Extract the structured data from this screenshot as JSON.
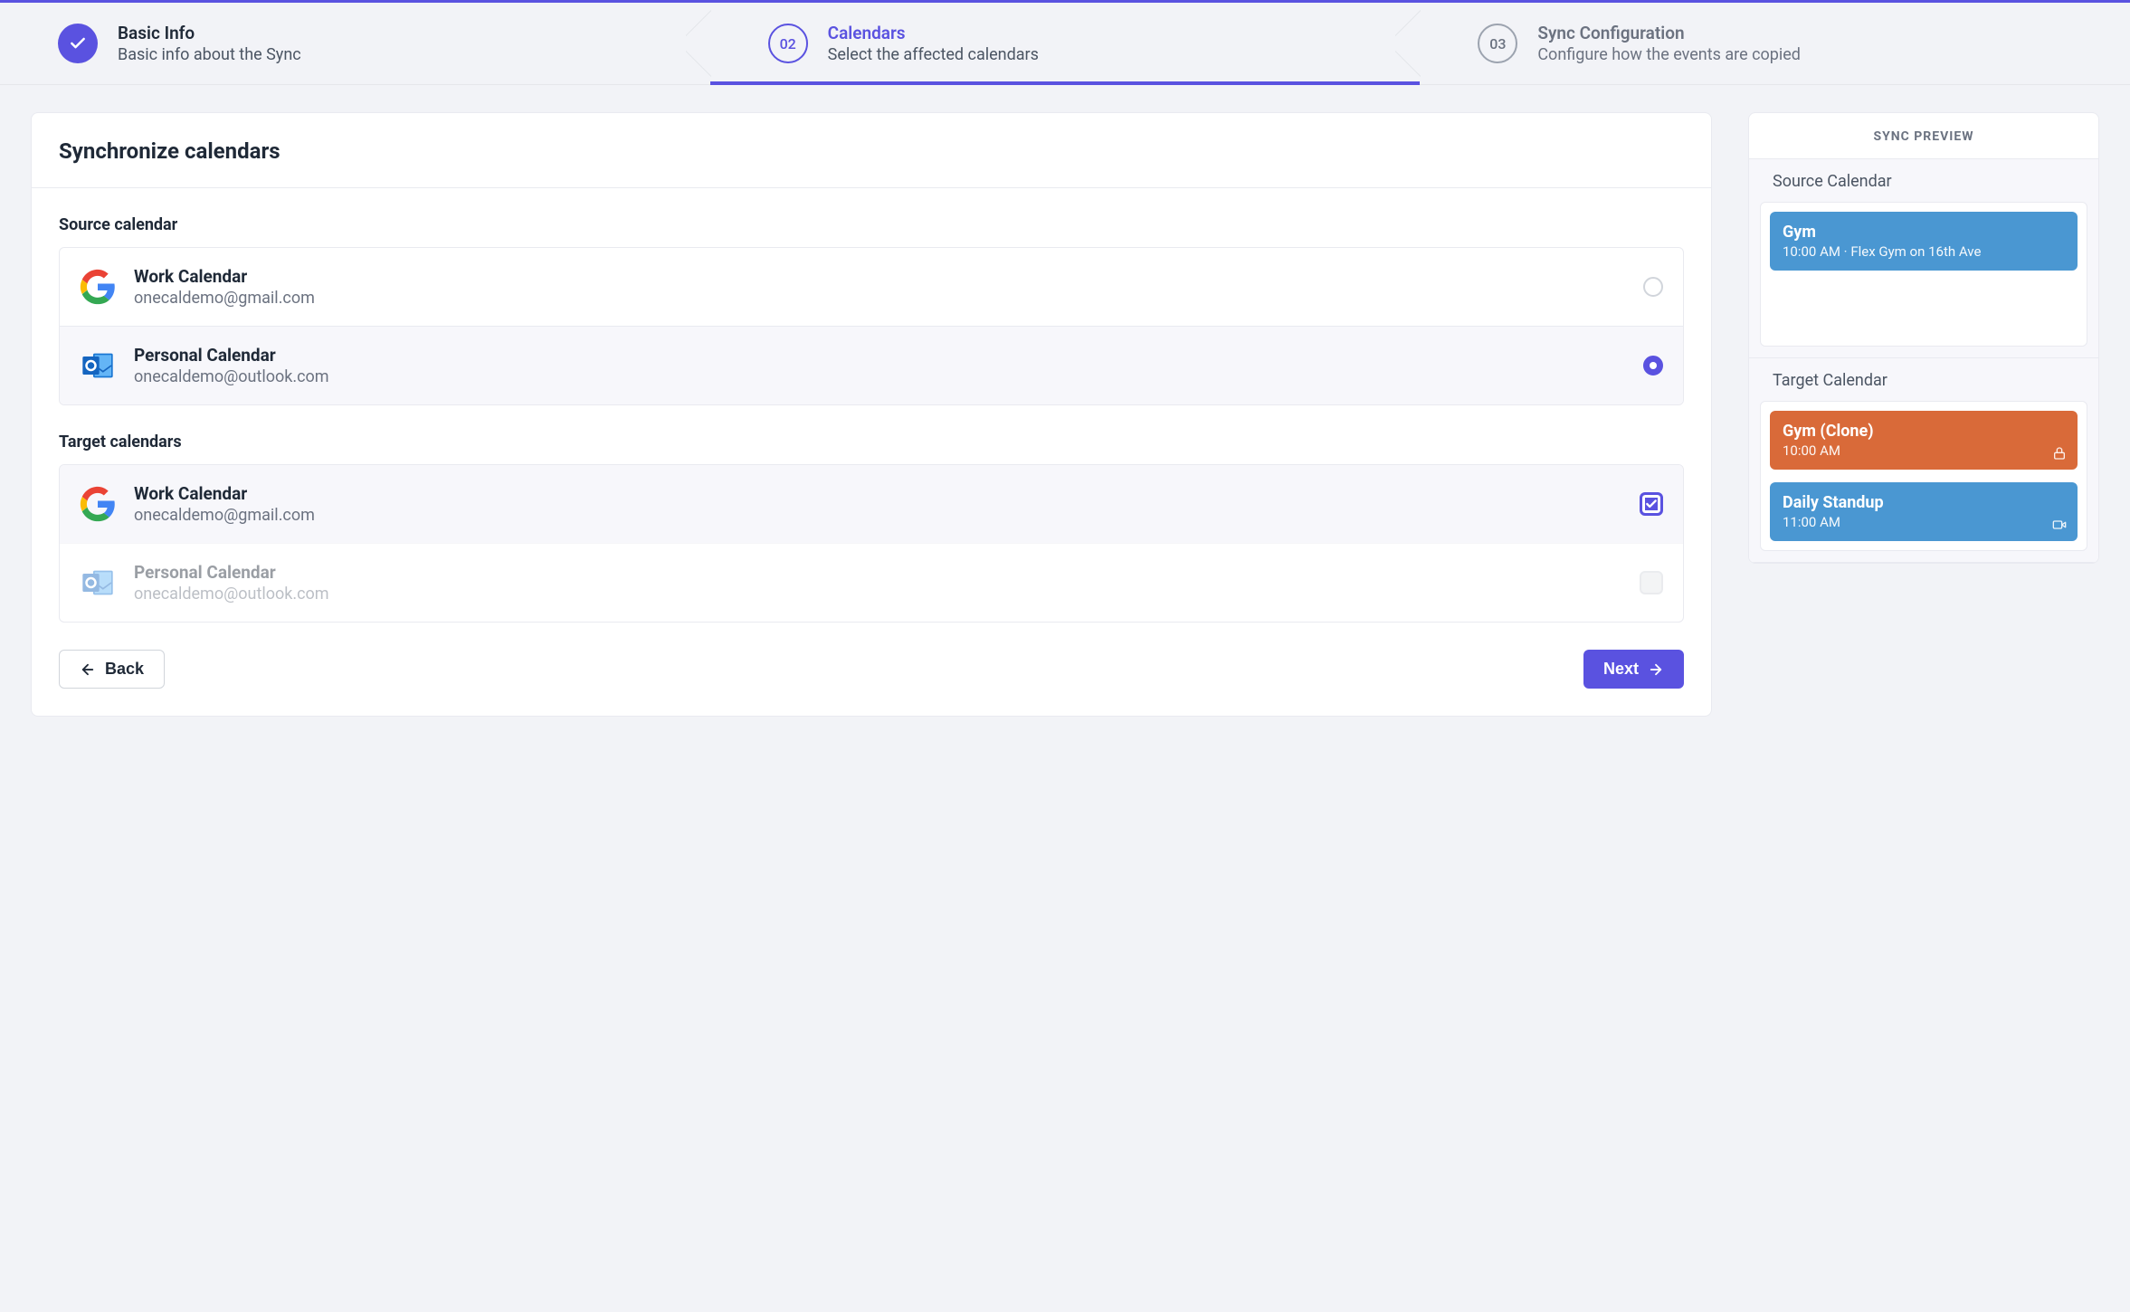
{
  "stepper": [
    {
      "badge": "check",
      "title": "Basic Info",
      "sub": "Basic info about the Sync",
      "state": "done"
    },
    {
      "badge": "02",
      "title": "Calendars",
      "sub": "Select the affected calendars",
      "state": "active"
    },
    {
      "badge": "03",
      "title": "Sync Configuration",
      "sub": "Configure how the events are copied",
      "state": "todo"
    }
  ],
  "main": {
    "header": "Synchronize calendars",
    "source_label": "Source calendar",
    "target_label": "Target calendars",
    "source": [
      {
        "provider": "google",
        "name": "Work Calendar",
        "email": "onecaldemo@gmail.com",
        "selected": false
      },
      {
        "provider": "outlook",
        "name": "Personal Calendar",
        "email": "onecaldemo@outlook.com",
        "selected": true
      }
    ],
    "target": [
      {
        "provider": "google",
        "name": "Work Calendar",
        "email": "onecaldemo@gmail.com",
        "checked": true,
        "disabled": false
      },
      {
        "provider": "outlook",
        "name": "Personal Calendar",
        "email": "onecaldemo@outlook.com",
        "checked": false,
        "disabled": true
      }
    ],
    "back": "Back",
    "next": "Next"
  },
  "preview": {
    "title": "SYNC PREVIEW",
    "source_label": "Source Calendar",
    "target_label": "Target Calendar",
    "source_events": [
      {
        "title": "Gym",
        "sub": "10:00 AM · Flex Gym on 16th Ave",
        "color": "blue",
        "icon": null
      }
    ],
    "target_events": [
      {
        "title": "Gym (Clone)",
        "sub": "10:00 AM",
        "color": "orange",
        "icon": "lock"
      },
      {
        "title": "Daily Standup",
        "sub": "11:00 AM",
        "color": "blue",
        "icon": "video"
      }
    ]
  }
}
